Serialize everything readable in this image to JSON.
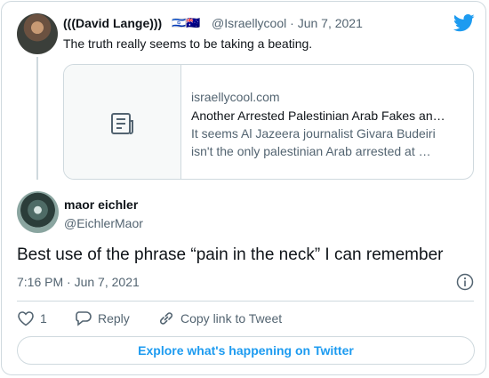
{
  "quoted_tweet": {
    "name": "(((David Lange)))",
    "flags": "🇮🇱🇦🇺",
    "handle": "@Israellycool",
    "date": "Jun 7, 2021",
    "text": "The truth really seems to be taking a beating.",
    "link_card": {
      "domain": "israellycool.com",
      "title": "Another Arrested Palestinian Arab Fakes an…",
      "description_line1": "It seems Al Jazeera journalist Givara Budeiri",
      "description_line2": "isn't the only palestinian Arab arrested at …",
      "thumbnail_icon": "article-icon"
    }
  },
  "tweet": {
    "name": "maor eichler",
    "handle": "@EichlerMaor",
    "text": "Best use of the phrase “pain in the neck” I can remember",
    "time": "7:16 PM",
    "date": "Jun 7, 2021"
  },
  "actions": {
    "like_count": "1",
    "reply_label": "Reply",
    "copy_label": "Copy link to Tweet"
  },
  "explore_label": "Explore what's happening on Twitter",
  "colors": {
    "accent": "#1d9bf0",
    "secondary_text": "#536471",
    "border": "#cfd9de"
  },
  "icons": [
    "twitter-bird-icon",
    "article-icon",
    "info-icon",
    "heart-icon",
    "reply-icon",
    "link-icon"
  ]
}
